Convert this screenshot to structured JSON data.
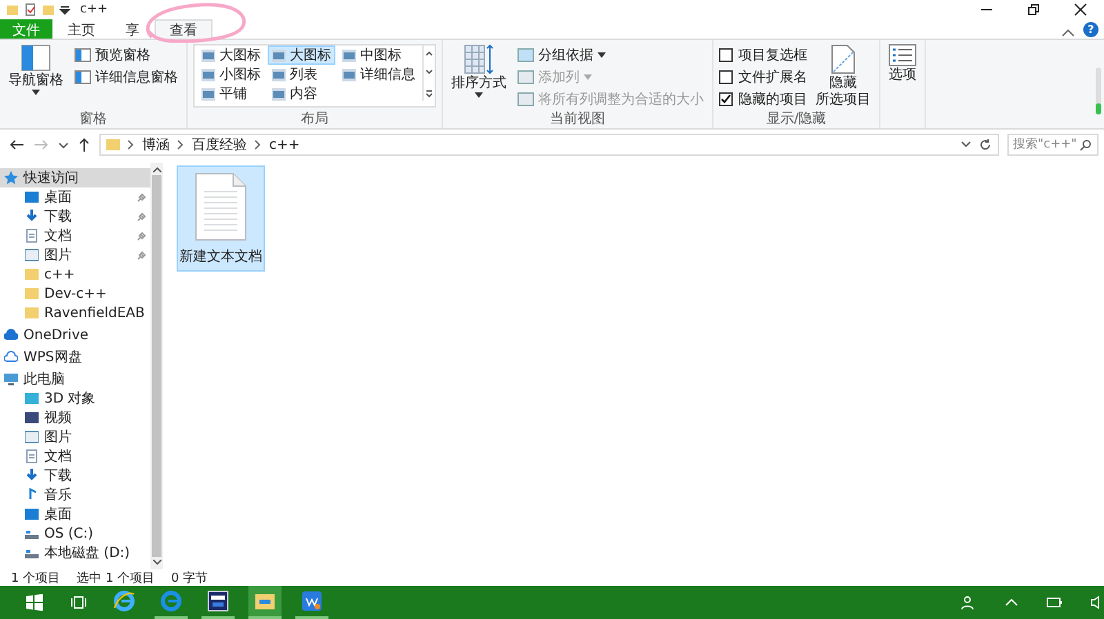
{
  "window": {
    "title": "c++",
    "help": "?"
  },
  "tabs": [
    {
      "label": "文件",
      "kind": "file",
      "selected": false
    },
    {
      "label": "主页",
      "kind": "tab",
      "selected": false
    },
    {
      "label": "享",
      "kind": "tab",
      "selected": false
    },
    {
      "label": "查看",
      "kind": "tab",
      "selected": true
    }
  ],
  "ribbon": {
    "panes": {
      "label": "窗格",
      "large": {
        "label": "导航窗格"
      },
      "small": [
        {
          "label": "预览窗格"
        },
        {
          "label": "详细信息窗格"
        }
      ]
    },
    "layout": {
      "label": "布局",
      "items": [
        {
          "label": "大图标",
          "selected": false
        },
        {
          "label": "大图标",
          "selected": true
        },
        {
          "label": "中图标",
          "selected": false
        },
        {
          "label": "小图标",
          "selected": false
        },
        {
          "label": "列表",
          "selected": false
        },
        {
          "label": "详细信息",
          "selected": false
        },
        {
          "label": "平铺",
          "selected": false
        },
        {
          "label": "内容",
          "selected": false
        }
      ]
    },
    "current_view": {
      "label": "当前视图",
      "large": {
        "label": "排序方式"
      },
      "small": [
        {
          "label": "分组依据",
          "disabled": false,
          "dropdown": true
        },
        {
          "label": "添加列",
          "disabled": true,
          "dropdown": true
        },
        {
          "label": "将所有列调整为合适的大小",
          "disabled": true,
          "dropdown": false
        }
      ]
    },
    "show_hide": {
      "label": "显示/隐藏",
      "checkboxes": [
        {
          "label": "项目复选框",
          "checked": false
        },
        {
          "label": "文件扩展名",
          "checked": false
        },
        {
          "label": "隐藏的项目",
          "checked": true
        }
      ],
      "large": {
        "lines": [
          "隐藏",
          "所选项目"
        ]
      }
    },
    "options": {
      "label": "选项"
    }
  },
  "address": {
    "crumbs": [
      "博涵",
      "百度经验",
      "c++"
    ],
    "search": {
      "placeholder": "搜索\"c++\""
    }
  },
  "sidebar": {
    "items": [
      {
        "label": "快速访问",
        "kind": "star",
        "selected": true,
        "children": [
          {
            "label": "桌面",
            "kind": "desktop",
            "pinned": true,
            "selected": false
          },
          {
            "label": "下载",
            "kind": "download",
            "pinned": true,
            "selected": false
          },
          {
            "label": "文档",
            "kind": "document",
            "pinned": true,
            "selected": false
          },
          {
            "label": "图片",
            "kind": "pictures",
            "pinned": true,
            "selected": false
          },
          {
            "label": "c++",
            "kind": "folder",
            "pinned": false,
            "selected": false
          },
          {
            "label": "Dev-c++",
            "kind": "folder",
            "pinned": false,
            "selected": false
          },
          {
            "label": "RavenfieldEAB",
            "kind": "folder",
            "pinned": false,
            "selected": false
          }
        ]
      },
      {
        "label": "OneDrive",
        "kind": "cloud",
        "selected": false
      },
      {
        "label": "WPS网盘",
        "kind": "cloud-outline",
        "selected": false
      },
      {
        "label": "此电脑",
        "kind": "pc",
        "selected": false,
        "children": [
          {
            "label": "3D 对象",
            "kind": "cube",
            "pinned": false,
            "selected": false
          },
          {
            "label": "视频",
            "kind": "video",
            "pinned": false,
            "selected": false
          },
          {
            "label": "图片",
            "kind": "pictures",
            "pinned": false,
            "selected": false
          },
          {
            "label": "文档",
            "kind": "document",
            "pinned": false,
            "selected": false
          },
          {
            "label": "下载",
            "kind": "download",
            "pinned": false,
            "selected": false
          },
          {
            "label": "音乐",
            "kind": "music",
            "pinned": false,
            "selected": false
          },
          {
            "label": "桌面",
            "kind": "desktop",
            "pinned": false,
            "selected": false
          },
          {
            "label": "OS (C:)",
            "kind": "drive",
            "pinned": false,
            "selected": false
          },
          {
            "label": "本地磁盘 (D:)",
            "kind": "drive",
            "pinned": false,
            "selected": false
          }
        ]
      }
    ]
  },
  "files": [
    {
      "name": "新建文本文档",
      "selected": true
    }
  ],
  "status_bar": [
    "1 个项目",
    "选中 1 个项目",
    "0 字节"
  ],
  "taskbar": {
    "apps": [
      {
        "kind": "ie",
        "running": false,
        "selected": false
      },
      {
        "kind": "edge",
        "running": true,
        "selected": false
      },
      {
        "kind": "devcpp",
        "running": true,
        "selected": false
      },
      {
        "kind": "explorer",
        "running": true,
        "selected": true
      },
      {
        "kind": "wps",
        "running": true,
        "selected": false
      }
    ]
  }
}
